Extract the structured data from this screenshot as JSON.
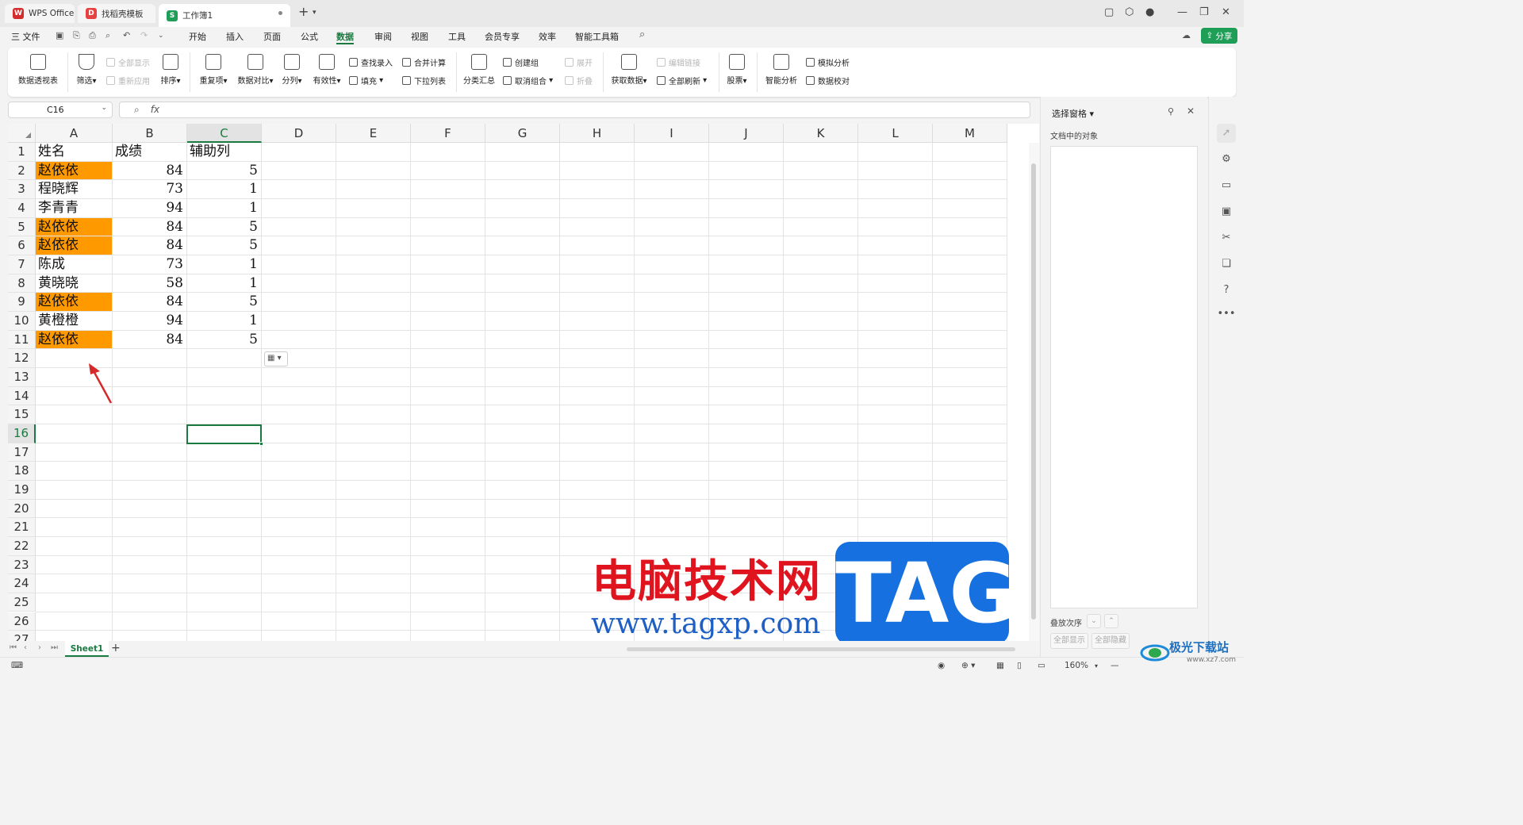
{
  "tabs": [
    {
      "label": "WPS Office",
      "icon": "W",
      "color": "#d42d2d"
    },
    {
      "label": "找稻壳模板",
      "icon": "D",
      "color": "#e64242"
    },
    {
      "label": "工作簿1",
      "icon": "S",
      "color": "#1e9e57"
    }
  ],
  "menu": {
    "file": "三 文件",
    "items": [
      "开始",
      "插入",
      "页面",
      "公式",
      "数据",
      "审阅",
      "视图",
      "工具",
      "会员专享",
      "效率",
      "智能工具箱"
    ],
    "active": "数据",
    "share": "分享"
  },
  "ribbon": {
    "pivot": "数据透视表",
    "filter": "筛选",
    "show_all": "全部显示",
    "reapply": "重新应用",
    "sort": "排序",
    "dup": "重复项",
    "compare": "数据对比",
    "split": "分列",
    "valid": "有效性",
    "lookup": "查找录入",
    "fill": "填充",
    "consol": "合并计算",
    "dropdown": "下拉列表",
    "subtotal": "分类汇总",
    "group": "创建组",
    "ungroup": "取消组合",
    "expand": "展开",
    "collapse": "折叠",
    "getdata": "获取数据",
    "editlinks": "编辑链接",
    "refresh": "全部刷新",
    "stock": "股票",
    "smart": "智能分析",
    "simulate": "模拟分析",
    "proof": "数据校对"
  },
  "formula": {
    "namebox": "C16",
    "fx": "fx",
    "value": ""
  },
  "columns": [
    "A",
    "B",
    "C",
    "D",
    "E",
    "F",
    "G",
    "H",
    "I",
    "J",
    "K",
    "L",
    "M"
  ],
  "rows": [
    "1",
    "2",
    "3",
    "4",
    "5",
    "6",
    "7",
    "8",
    "9",
    "10",
    "11",
    "12",
    "13",
    "14",
    "15",
    "16",
    "17",
    "18",
    "19",
    "20",
    "21",
    "22",
    "23",
    "24",
    "25",
    "26",
    "27"
  ],
  "table": {
    "headers": [
      "姓名",
      "成绩",
      "辅助列"
    ],
    "data": [
      {
        "name": "赵依依",
        "score": "84",
        "aux": "5",
        "hl": true
      },
      {
        "name": "程晓辉",
        "score": "73",
        "aux": "1",
        "hl": false
      },
      {
        "name": "李青青",
        "score": "94",
        "aux": "1",
        "hl": false
      },
      {
        "name": "赵依依",
        "score": "84",
        "aux": "5",
        "hl": true
      },
      {
        "name": "赵依依",
        "score": "84",
        "aux": "5",
        "hl": true
      },
      {
        "name": "陈成",
        "score": "73",
        "aux": "1",
        "hl": false
      },
      {
        "name": "黄晓晓",
        "score": "58",
        "aux": "1",
        "hl": false
      },
      {
        "name": "赵依依",
        "score": "84",
        "aux": "5",
        "hl": true
      },
      {
        "name": "黄橙橙",
        "score": "94",
        "aux": "1",
        "hl": false
      },
      {
        "name": "赵依依",
        "score": "84",
        "aux": "5",
        "hl": true
      }
    ],
    "highlight_color": "#ff9900"
  },
  "selected_cell": "C16",
  "sheet": {
    "name": "Sheet1",
    "add": "+"
  },
  "status": {
    "zoom": "160%"
  },
  "pane": {
    "title": "选择窗格",
    "subtitle": "文档中的对象",
    "order": "叠放次序",
    "show_all": "全部显示",
    "hide_all": "全部隐藏"
  },
  "watermark": {
    "text": "电脑技术网",
    "url": "www.tagxp.com",
    "tag": "TAG",
    "logo": "极光下载站",
    "logo_url": "www.xz7.com"
  },
  "brand_colors": {
    "green": "#1a7a3f",
    "orange": "#ff9900"
  }
}
